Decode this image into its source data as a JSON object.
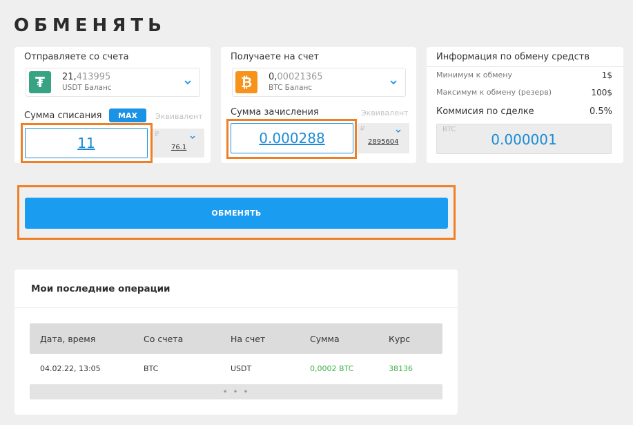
{
  "page": {
    "title": "ОБМЕНЯТЬ"
  },
  "send": {
    "label": "Отправляете со счета",
    "coin_symbol": "₮",
    "balance_int": "21,",
    "balance_frac": "413995",
    "balance_sub": "USDT Баланс",
    "amount_label": "Сумма списания",
    "max_label": "MAX",
    "equiv_label": "Эквивалент",
    "amount_value": "11",
    "equiv_currency": "₽",
    "equiv_value": "76.1",
    "icon_color": "#37a382"
  },
  "receive": {
    "label": "Получаете на счет",
    "coin_symbol": "₿",
    "balance_int": "0,",
    "balance_frac": "00021365",
    "balance_sub": "BTC Баланс",
    "amount_label": "Сумма зачисления",
    "equiv_label": "Эквивалент",
    "amount_value": "0.000288",
    "equiv_currency": "₽",
    "equiv_value": "2895604",
    "icon_color": "#f7931a"
  },
  "info": {
    "title": "Информация по обмену средств",
    "min_label": "Минимум к обмену",
    "min_value": "1$",
    "max_label": "Максимум к обмену (резерв)",
    "max_value": "100$",
    "fee_label": "Коммисия по сделке",
    "fee_value": "0.5%",
    "fee_currency": "BTC",
    "fee_amount": "0.000001"
  },
  "exchange_button": {
    "label": "ОБМЕНЯТЬ"
  },
  "operations": {
    "title": "Мои последние операции",
    "columns": [
      "Дата, время",
      "Со счета",
      "На счет",
      "Сумма",
      "Курс"
    ],
    "rows": [
      {
        "datetime": "04.02.22, 13:05",
        "from": "BTC",
        "to": "USDT",
        "amount": "0,0002 BTC",
        "rate": "38136"
      }
    ],
    "more_label": "• • •"
  },
  "colors": {
    "accent": "#1a9cf0",
    "highlight": "#f07f24",
    "positive": "#3cb043"
  }
}
